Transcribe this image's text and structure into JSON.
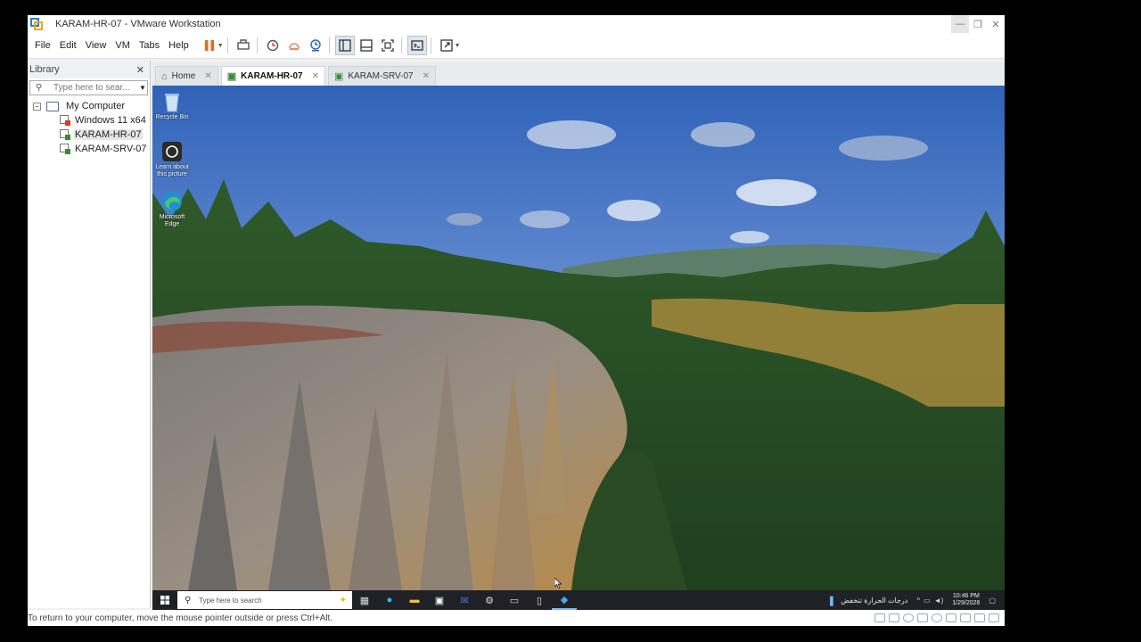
{
  "window": {
    "title": "KARAM-HR-07 - VMware Workstation"
  },
  "menu": [
    "File",
    "Edit",
    "View",
    "VM",
    "Tabs",
    "Help"
  ],
  "library": {
    "title": "Library",
    "search_placeholder": "Type here to sear...",
    "root": "My Computer",
    "items": [
      {
        "label": "Windows 11 x64",
        "state": "off"
      },
      {
        "label": "KARAM-HR-07",
        "state": "running"
      },
      {
        "label": "KARAM-SRV-07",
        "state": "running"
      }
    ]
  },
  "tabs": [
    {
      "label": "Home",
      "active": false
    },
    {
      "label": "KARAM-HR-07",
      "active": true
    },
    {
      "label": "KARAM-SRV-07",
      "active": false
    }
  ],
  "desktop": {
    "icons": [
      {
        "label": "Recycle Bin"
      },
      {
        "label": "Learn about this picture"
      },
      {
        "label": "Microsoft Edge"
      }
    ]
  },
  "taskbar": {
    "search_placeholder": "Type here to search",
    "weather": "درجات الحرارة تنخفض",
    "time": "10:46 PM",
    "date": "1/29/2026"
  },
  "status": {
    "text": "To return to your computer, move the mouse pointer outside or press Ctrl+Alt."
  },
  "colors": {
    "accent": "#1d7fd1",
    "running": "#3b8a3b",
    "taskbar": "#1f2126"
  }
}
